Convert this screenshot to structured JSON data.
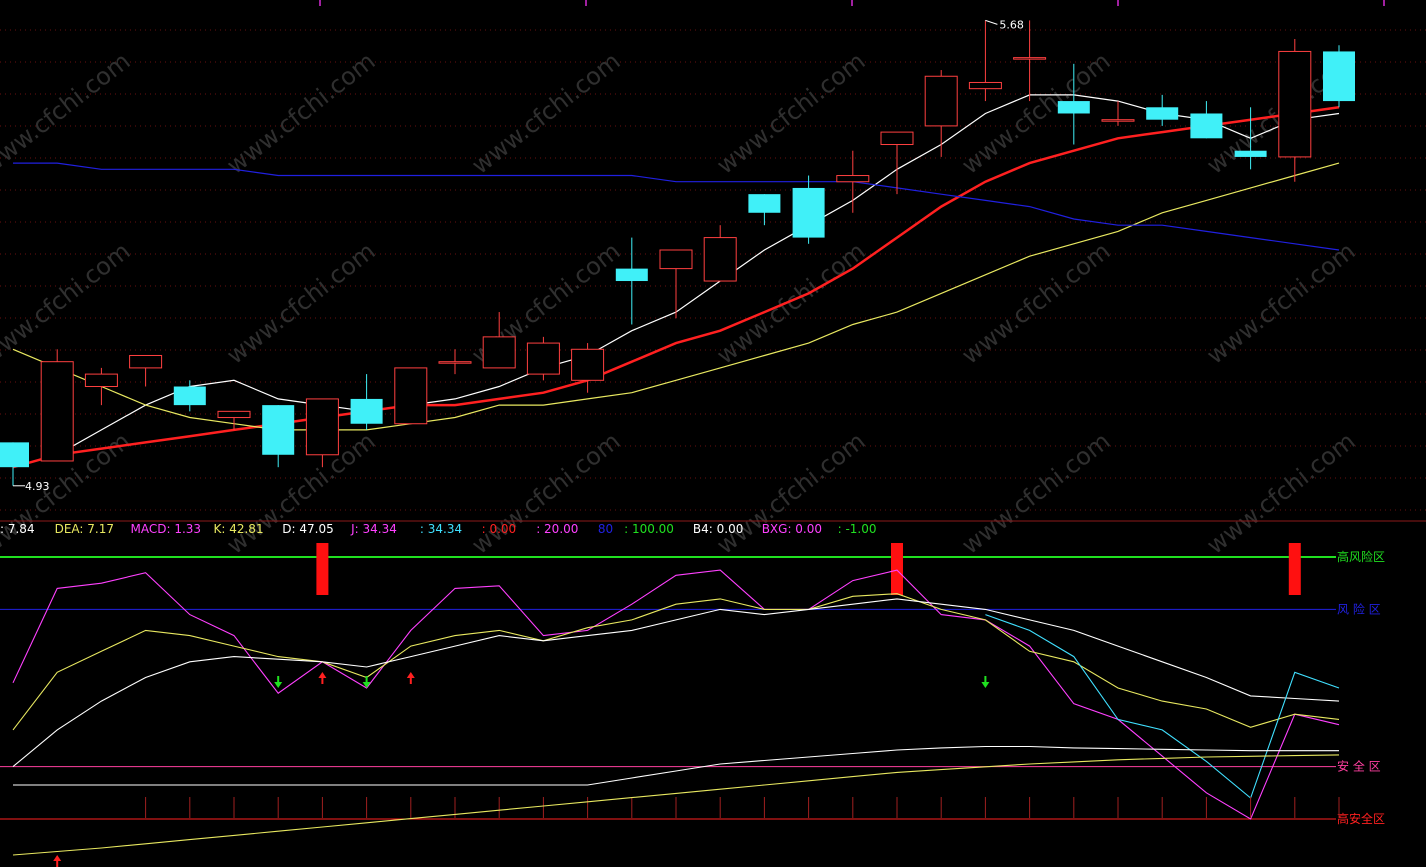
{
  "chart_data": [
    {
      "type": "candlestick",
      "price_labels": {
        "high": "5.68",
        "low": "4.93"
      },
      "candles": [
        {
          "o": 5.0,
          "c": 4.96,
          "h": 5.0,
          "l": 4.93
        },
        {
          "o": 4.97,
          "c": 5.13,
          "h": 5.15,
          "l": 4.97
        },
        {
          "o": 5.09,
          "c": 5.11,
          "h": 5.12,
          "l": 5.06
        },
        {
          "o": 5.12,
          "c": 5.14,
          "h": 5.14,
          "l": 5.09
        },
        {
          "o": 5.09,
          "c": 5.06,
          "h": 5.1,
          "l": 5.05
        },
        {
          "o": 5.04,
          "c": 5.05,
          "h": 5.05,
          "l": 5.02
        },
        {
          "o": 5.06,
          "c": 4.98,
          "h": 5.06,
          "l": 4.96
        },
        {
          "o": 4.98,
          "c": 5.07,
          "h": 5.07,
          "l": 4.96
        },
        {
          "o": 5.07,
          "c": 5.03,
          "h": 5.11,
          "l": 5.02
        },
        {
          "o": 5.03,
          "c": 5.12,
          "h": 5.12,
          "l": 5.03
        },
        {
          "o": 5.13,
          "c": 5.13,
          "h": 5.15,
          "l": 5.11
        },
        {
          "o": 5.12,
          "c": 5.17,
          "h": 5.21,
          "l": 5.12
        },
        {
          "o": 5.11,
          "c": 5.16,
          "h": 5.17,
          "l": 5.1
        },
        {
          "o": 5.1,
          "c": 5.15,
          "h": 5.16,
          "l": 5.08
        },
        {
          "o": 5.28,
          "c": 5.26,
          "h": 5.33,
          "l": 5.19
        },
        {
          "o": 5.28,
          "c": 5.31,
          "h": 5.31,
          "l": 5.2
        },
        {
          "o": 5.26,
          "c": 5.33,
          "h": 5.35,
          "l": 5.26
        },
        {
          "o": 5.4,
          "c": 5.37,
          "h": 5.4,
          "l": 5.35
        },
        {
          "o": 5.41,
          "c": 5.33,
          "h": 5.43,
          "l": 5.32
        },
        {
          "o": 5.42,
          "c": 5.43,
          "h": 5.47,
          "l": 5.37
        },
        {
          "o": 5.48,
          "c": 5.5,
          "h": 5.5,
          "l": 5.4
        },
        {
          "o": 5.51,
          "c": 5.59,
          "h": 5.6,
          "l": 5.46
        },
        {
          "o": 5.57,
          "c": 5.58,
          "h": 5.68,
          "l": 5.55
        },
        {
          "o": 5.62,
          "c": 5.62,
          "h": 5.68,
          "l": 5.55
        },
        {
          "o": 5.55,
          "c": 5.53,
          "h": 5.61,
          "l": 5.48
        },
        {
          "o": 5.52,
          "c": 5.52,
          "h": 5.55,
          "l": 5.51
        },
        {
          "o": 5.54,
          "c": 5.52,
          "h": 5.56,
          "l": 5.51
        },
        {
          "o": 5.53,
          "c": 5.49,
          "h": 5.55,
          "l": 5.49
        },
        {
          "o": 5.47,
          "c": 5.46,
          "h": 5.54,
          "l": 5.44
        },
        {
          "o": 5.46,
          "c": 5.63,
          "h": 5.65,
          "l": 5.42
        },
        {
          "o": 5.63,
          "c": 5.55,
          "h": 5.64,
          "l": 5.54
        }
      ],
      "ma_lines": [
        {
          "color": "#ffffff",
          "values": [
            null,
            4.98,
            5.02,
            5.06,
            5.09,
            5.1,
            5.07,
            5.06,
            5.05,
            5.06,
            5.07,
            5.09,
            5.12,
            5.14,
            5.18,
            5.21,
            5.26,
            5.31,
            5.35,
            5.39,
            5.44,
            5.48,
            5.53,
            5.56,
            5.56,
            5.55,
            5.53,
            5.52,
            5.49,
            5.52,
            5.53
          ]
        },
        {
          "color": "#ff2020",
          "values": [
            4.96,
            4.98,
            4.99,
            5.0,
            5.01,
            5.02,
            5.03,
            5.04,
            5.05,
            5.06,
            5.06,
            5.07,
            5.08,
            5.1,
            5.13,
            5.16,
            5.18,
            5.21,
            5.24,
            5.28,
            5.33,
            5.38,
            5.42,
            5.45,
            5.47,
            5.49,
            5.5,
            5.51,
            5.52,
            5.53,
            5.54
          ]
        },
        {
          "color": "#e8e860",
          "values": [
            5.15,
            5.12,
            5.09,
            5.06,
            5.04,
            5.03,
            5.02,
            5.02,
            5.02,
            5.03,
            5.04,
            5.06,
            5.06,
            5.07,
            5.08,
            5.1,
            5.12,
            5.14,
            5.16,
            5.19,
            5.21,
            5.24,
            5.27,
            5.3,
            5.32,
            5.34,
            5.37,
            5.39,
            5.41,
            5.43,
            5.45
          ]
        },
        {
          "color": "#2020e0",
          "values": [
            5.45,
            5.45,
            5.44,
            5.44,
            5.44,
            5.44,
            5.43,
            5.43,
            5.43,
            5.43,
            5.43,
            5.43,
            5.43,
            5.43,
            5.43,
            5.42,
            5.42,
            5.42,
            5.42,
            5.42,
            5.41,
            5.4,
            5.39,
            5.38,
            5.36,
            5.35,
            5.35,
            5.34,
            5.33,
            5.32,
            5.31
          ]
        }
      ]
    },
    {
      "type": "line",
      "legend": [
        {
          "text": ": 7.84",
          "color": "#ffffff"
        },
        {
          "text": "DEA: 7.17",
          "color": "#e8e860"
        },
        {
          "text": "MACD: 1.33",
          "color": "#ff40ff"
        },
        {
          "text": "K: 42.81",
          "color": "#e8e860"
        },
        {
          "text": "D: 47.05",
          "color": "#ffffff"
        },
        {
          "text": "J: 34.34",
          "color": "#ff40ff"
        },
        {
          "text": ": 34.34",
          "color": "#40e0ff"
        },
        {
          "text": ": 0.00",
          "color": "#ff2020"
        },
        {
          "text": ": 20.00",
          "color": "#ff40ff"
        },
        {
          "text": "80",
          "color": "#2020e0"
        },
        {
          "text": ": 100.00",
          "color": "#20e020"
        },
        {
          "text": "B4: 0.00",
          "color": "#ffffff"
        },
        {
          "text": "BXG: 0.00",
          "color": "#ff40ff"
        },
        {
          "text": ": -1.00",
          "color": "#20e020"
        }
      ],
      "zones": [
        {
          "label": "高风险区",
          "value": 100,
          "color": "#20e020"
        },
        {
          "label": "风 险 区",
          "value": 80,
          "color": "#2020e0"
        },
        {
          "label": "安 全 区",
          "value": 20,
          "color": "#ff40a0"
        },
        {
          "label": "高安全区",
          "value": 0,
          "color": "#ff2020"
        }
      ],
      "signal_bars_at": [
        7,
        20,
        29
      ],
      "up_arrows_at": [
        7,
        9
      ],
      "down_arrows_at": [
        6,
        8,
        22
      ],
      "lines": [
        {
          "color": "#ff40ff",
          "values": [
            52,
            88,
            90,
            94,
            78,
            70,
            48,
            60,
            50,
            72,
            88,
            89,
            70,
            72,
            82,
            93,
            95,
            80,
            80,
            91,
            95,
            78,
            76,
            66,
            44,
            38,
            24,
            10,
            0,
            40,
            36
          ]
        },
        {
          "color": "#e8e860",
          "values": [
            34,
            56,
            64,
            72,
            70,
            66,
            62,
            60,
            54,
            66,
            70,
            72,
            68,
            73,
            76,
            82,
            84,
            80,
            80,
            85,
            86,
            80,
            76,
            64,
            60,
            50,
            45,
            42,
            35,
            40,
            38
          ]
        },
        {
          "color": "#ffffff",
          "values": [
            20,
            34,
            45,
            54,
            60,
            62,
            61,
            60,
            58,
            62,
            66,
            70,
            68,
            70,
            72,
            76,
            80,
            78,
            80,
            82,
            84,
            82,
            80,
            76,
            72,
            66,
            60,
            54,
            47,
            46,
            45
          ]
        },
        {
          "color": "#40e0ff",
          "values": [
            null,
            null,
            null,
            null,
            null,
            null,
            null,
            null,
            null,
            null,
            null,
            null,
            null,
            null,
            null,
            null,
            null,
            null,
            null,
            null,
            null,
            null,
            78,
            72,
            62,
            38,
            34,
            22,
            8,
            56,
            50
          ]
        }
      ],
      "bottom_lines": [
        {
          "color": "#ffffff",
          "values": [
            0,
            0,
            0,
            0,
            0,
            0,
            0,
            0,
            0,
            0,
            0,
            0,
            0,
            0,
            1,
            2,
            3,
            3.5,
            4,
            4.5,
            5,
            5.3,
            5.5,
            5.5,
            5.3,
            5.2,
            5.1,
            5,
            4.9,
            4.9,
            4.9
          ]
        },
        {
          "color": "#e8e860",
          "values": [
            -10,
            -9.5,
            -9,
            -8.4,
            -7.8,
            -7.2,
            -6.6,
            -6,
            -5.4,
            -4.8,
            -4.2,
            -3.6,
            -3,
            -2.4,
            -1.8,
            -1.2,
            -0.6,
            0,
            0.6,
            1.2,
            1.8,
            2.2,
            2.6,
            3,
            3.3,
            3.6,
            3.8,
            4,
            4.1,
            4.2,
            4.3
          ]
        }
      ]
    }
  ],
  "watermark": "www.cfchi.com"
}
